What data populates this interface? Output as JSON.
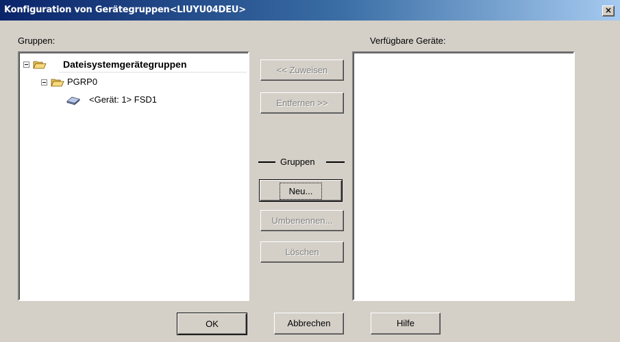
{
  "window": {
    "title": "Konfiguration von Gerätegruppen<LIUYU04DEU>",
    "close_label": "×"
  },
  "gruppen_label": "Gruppen:",
  "verfuegbar_label": "Verfügbare Geräte:",
  "tree": {
    "root": "Dateisystemgerätegruppen",
    "group": "PGRP0",
    "device": "<Gerät: 1> FSD1"
  },
  "buttons": {
    "zuweisen": "<< Zuweisen",
    "entfernen": "Entfernen >>",
    "neu": "Neu...",
    "umbenennen": "Umbenennen...",
    "loeschen": "Löschen",
    "ok": "OK",
    "abbrechen": "Abbrechen",
    "hilfe": "Hilfe"
  },
  "gruppen_section_label": "Gruppen",
  "colors": {
    "title_start": "#0a246a",
    "title_end": "#a6caf0",
    "face": "#d4d0c8",
    "folder": "#f7d87c"
  }
}
